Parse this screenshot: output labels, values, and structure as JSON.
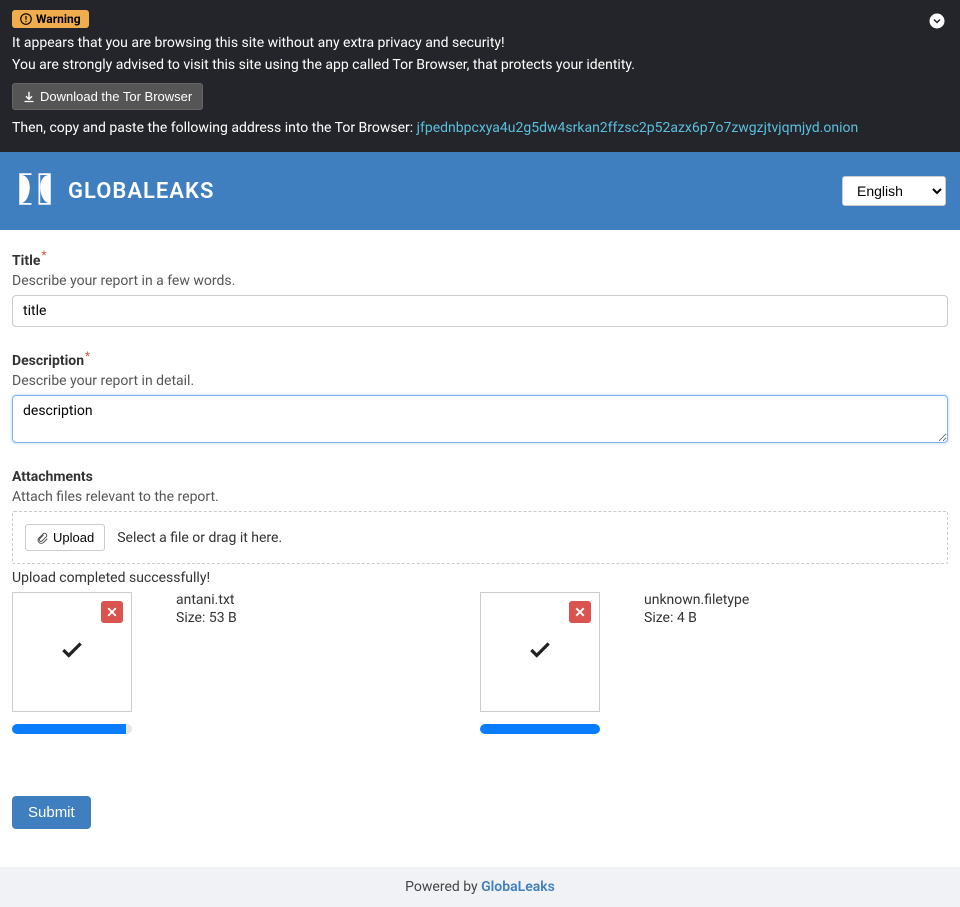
{
  "topbar": {
    "warning_label": "Warning",
    "line1": "It appears that you are browsing this site without any extra privacy and security!",
    "line2": "You are strongly advised to visit this site using the app called Tor Browser, that protects your identity.",
    "download_label": "Download the Tor Browser",
    "line3_prefix": "Then, copy and paste the following address into the Tor Browser: ",
    "onion_url": "jfpednbpcxya4u2g5dw4srkan2ffzsc2p52azx6p7o7zwgzjtvjqmjyd.onion"
  },
  "header": {
    "brand": "GLOBALEAKS",
    "language": "English"
  },
  "form": {
    "title": {
      "label": "Title",
      "hint": "Describe your report in a few words.",
      "value": "title"
    },
    "description": {
      "label": "Description",
      "hint": "Describe your report in detail.",
      "value": "description"
    },
    "attachments": {
      "label": "Attachments",
      "hint": "Attach files relevant to the report.",
      "upload_btn": "Upload",
      "upload_hint": "Select a file or drag it here.",
      "success_msg": "Upload completed successfully!",
      "files": [
        {
          "name": "antani.txt",
          "size": "Size: 53 B",
          "progress": 95
        },
        {
          "name": "unknown.filetype",
          "size": "Size: 4 B",
          "progress": 100
        }
      ]
    },
    "submit_label": "Submit"
  },
  "footer": {
    "prefix": "Powered by ",
    "link": "GlobaLeaks"
  }
}
